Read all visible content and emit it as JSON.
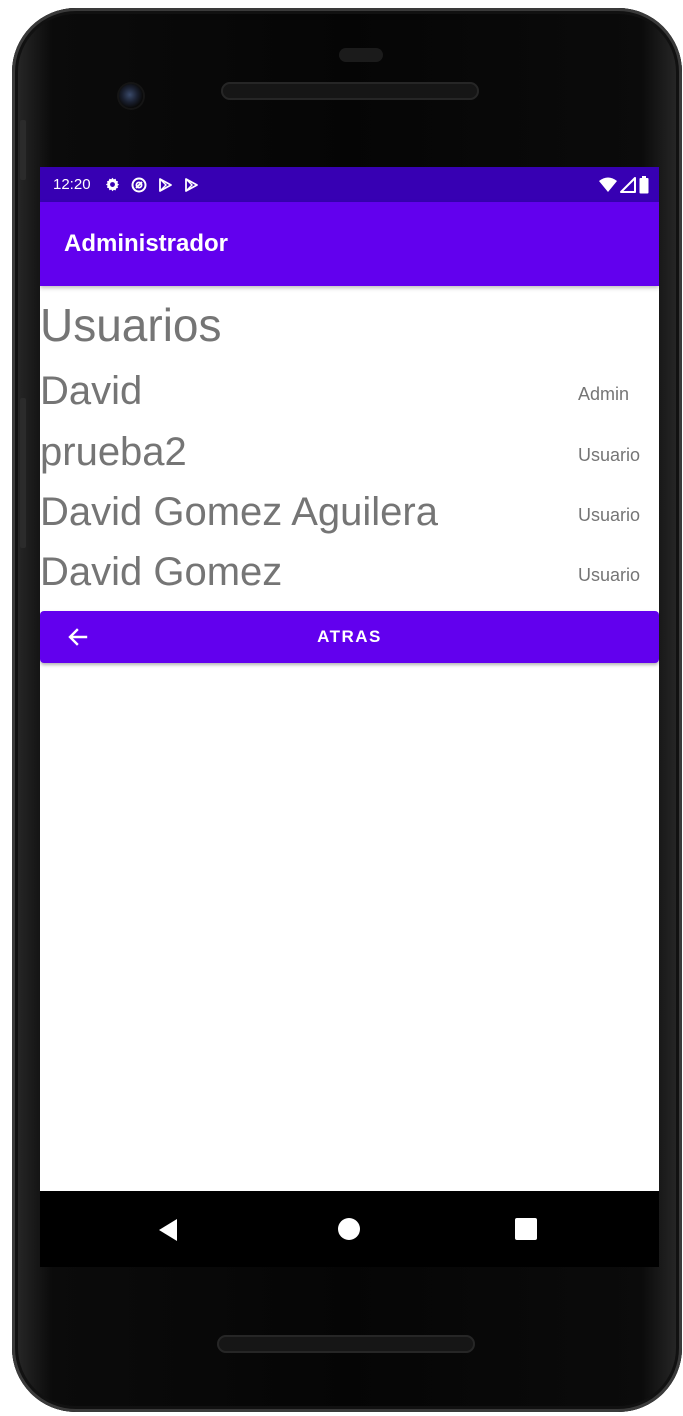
{
  "status_bar": {
    "time": "12:20",
    "left_icons": [
      "gear-icon",
      "sync-icon",
      "play-store-icon",
      "play-store-icon"
    ],
    "right_icons": [
      "wifi-icon",
      "signal-icon",
      "battery-icon"
    ],
    "color": "#3700b3"
  },
  "app_bar": {
    "title": "Administrador",
    "color": "#6200ee"
  },
  "main": {
    "heading": "Usuarios",
    "users": [
      {
        "name": "David",
        "role": "Admin"
      },
      {
        "name": "prueba2",
        "role": "Usuario"
      },
      {
        "name": "David Gomez Aguilera",
        "role": "Usuario"
      },
      {
        "name": "David Gomez",
        "role": "Usuario"
      }
    ]
  },
  "back_button": {
    "label": "ATRAS",
    "icon": "arrow-left-icon",
    "color": "#6200ee"
  },
  "nav_bar": {
    "icons": [
      "nav-back-icon",
      "nav-home-icon",
      "nav-recents-icon"
    ]
  }
}
